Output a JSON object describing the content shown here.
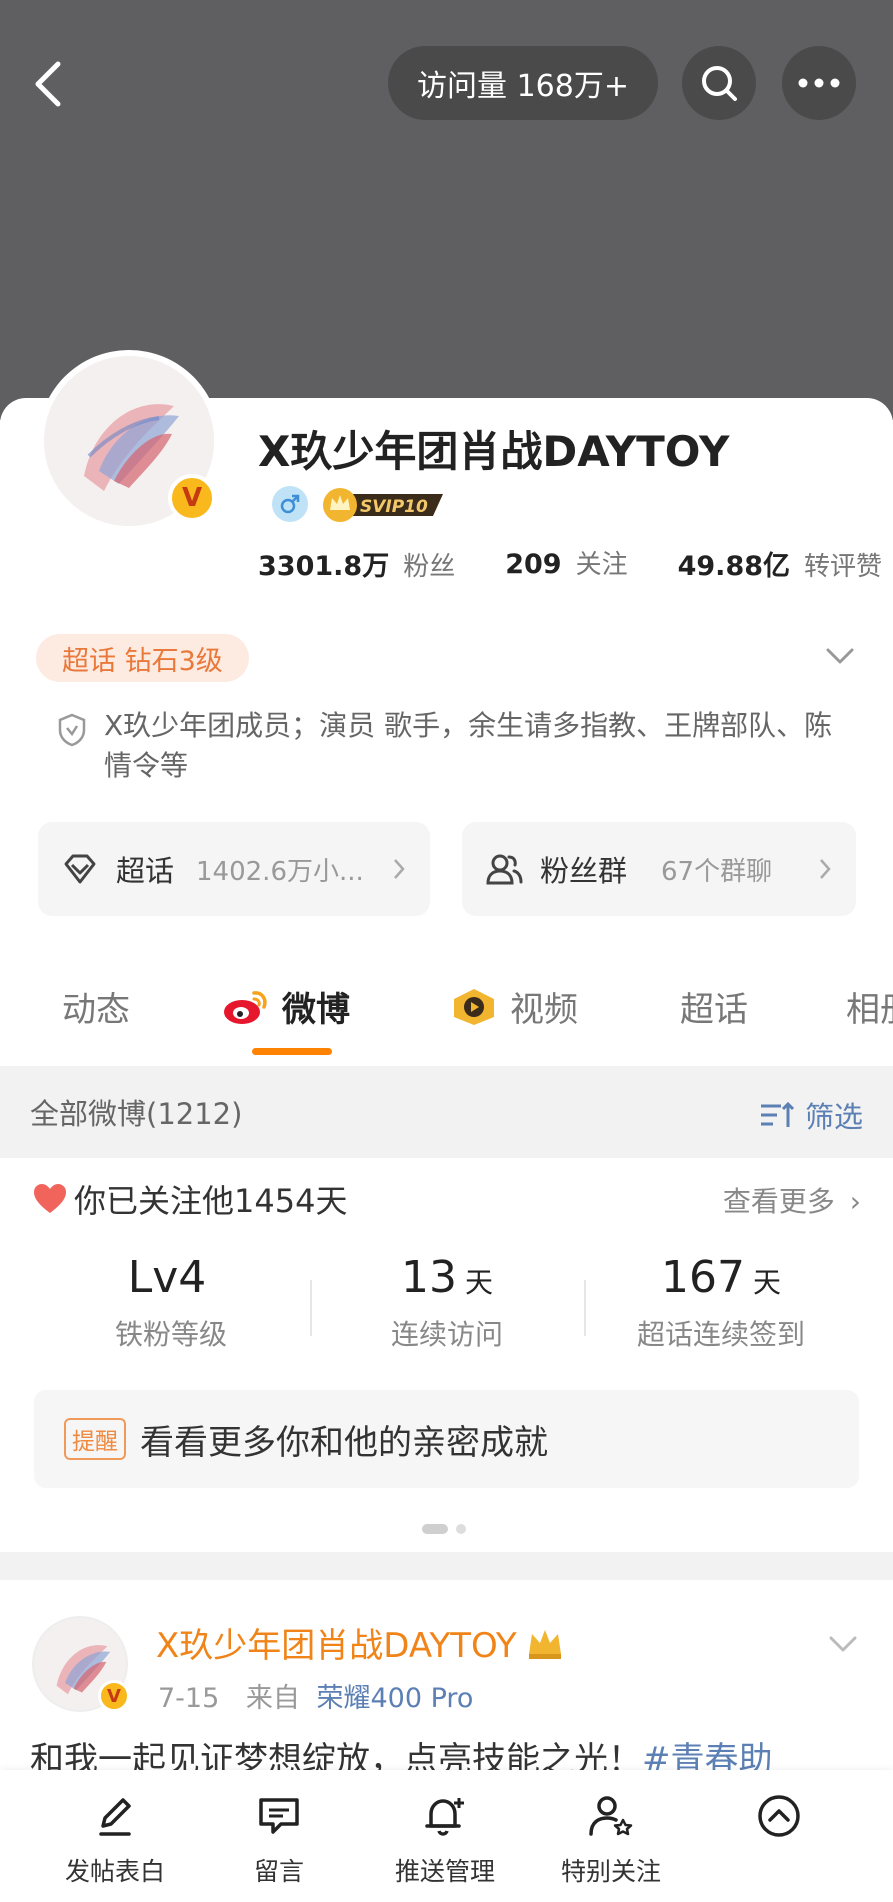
{
  "header": {
    "visit_count": "访问量 168万+"
  },
  "profile": {
    "name": "X玖少年团肖战DAYTOY",
    "verify_badge": "V",
    "svip": "SVIP10",
    "stats": [
      {
        "num": "3301.8万",
        "label": "粉丝"
      },
      {
        "num": "209",
        "label": "关注"
      },
      {
        "num": "49.88亿",
        "label": "转评赞"
      }
    ],
    "chaohua_level": "超话 钻石3级",
    "description": "X玖少年团成员；演员 歌手，余生请多指教、王牌部队、陈情令等"
  },
  "entries": {
    "chaohua": {
      "title": "超话",
      "sub": "1402.6万小..."
    },
    "fans": {
      "title": "粉丝群",
      "sub": "67个群聊"
    }
  },
  "tabs": [
    "动态",
    "微博",
    "视频",
    "超话",
    "相册"
  ],
  "filter": {
    "label": "全部微博(1212)",
    "action": "筛选"
  },
  "fan_box": {
    "follow_days": "你已关注他1454天",
    "see_more": "查看更多",
    "stats": [
      {
        "num": "Lv4",
        "unit": "",
        "label": "铁粉等级"
      },
      {
        "num": "13",
        "unit": "天",
        "label": "连续访问"
      },
      {
        "num": "167",
        "unit": "天",
        "label": "超话连续签到"
      }
    ],
    "remind_tag": "提醒",
    "remind_text": "看看更多你和他的亲密成就"
  },
  "post": {
    "author": "X玖少年团肖战DAYTOY",
    "date": "7-15",
    "from_label": "来自",
    "source": "荣耀400 Pro",
    "text_plain": "和我一起见证梦想绽放，点亮技能之光！",
    "text_tag": "#青春助"
  },
  "bottom_bar": [
    "发帖表白",
    "留言",
    "推送管理",
    "特别关注",
    ""
  ]
}
